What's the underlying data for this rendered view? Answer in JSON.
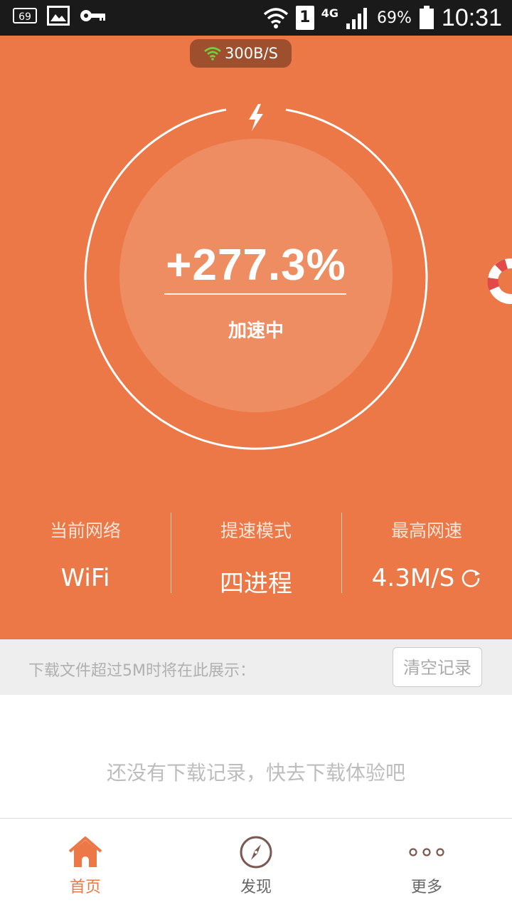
{
  "status_bar": {
    "notification_count": "69",
    "sim_slot": "1",
    "network_type": "4G",
    "battery": "69%",
    "time": "10:31"
  },
  "hero": {
    "live_speed": "300B/S",
    "boost_percent": "+277.3%",
    "state_label": "加速中",
    "stats": [
      {
        "label": "当前网络",
        "value": "WiFi"
      },
      {
        "label": "提速模式",
        "value": "四进程"
      },
      {
        "label": "最高网速",
        "value": "4.3M/S"
      }
    ]
  },
  "downloads": {
    "notice": "下载文件超过5M时将在此展示：",
    "clear_label": "清空记录",
    "empty_text": "还没有下载记录，快去下载体验吧"
  },
  "tabs": [
    {
      "label": "首页",
      "icon": "home-icon",
      "active": true
    },
    {
      "label": "发现",
      "icon": "compass-icon",
      "active": false
    },
    {
      "label": "更多",
      "icon": "more-icon",
      "active": false
    }
  ],
  "colors": {
    "accent": "#ec7847",
    "pill": "#9e4f2e",
    "wifi_green": "#6ed33c"
  }
}
